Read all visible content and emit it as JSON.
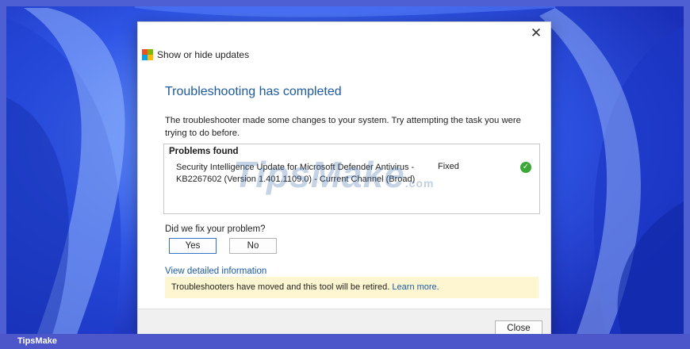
{
  "dialog": {
    "window_title": "Show or hide updates",
    "close_glyph": "✕",
    "heading": "Troubleshooting has completed",
    "description": "The troubleshooter made some changes to your system. Try attempting the task you were trying to do before.",
    "problems": {
      "title": "Problems found",
      "items": [
        {
          "name": "Security Intelligence Update for Microsoft Defender Antivirus - KB2267602 (Version 1.401.1109.0) - Current Channel (Broad)",
          "status": "Fixed",
          "status_icon": "checkmark-circle-icon"
        }
      ]
    },
    "question": "Did we fix your problem?",
    "yes_label": "Yes",
    "no_label": "No",
    "details_link": "View detailed information",
    "notice_text": "Troubleshooters have moved and this tool will be retired.",
    "notice_link": "Learn more.",
    "close_label": "Close"
  },
  "watermark": {
    "text": "TipsMake",
    "suffix": ".com"
  },
  "footer_brand": "TipsMake",
  "colors": {
    "accent_blue": "#1c5aa6",
    "notice_bg": "#fdf6d0",
    "success_green": "#3aa835",
    "logo": [
      "#f25022",
      "#7fba00",
      "#00a4ef",
      "#ffb900"
    ]
  }
}
